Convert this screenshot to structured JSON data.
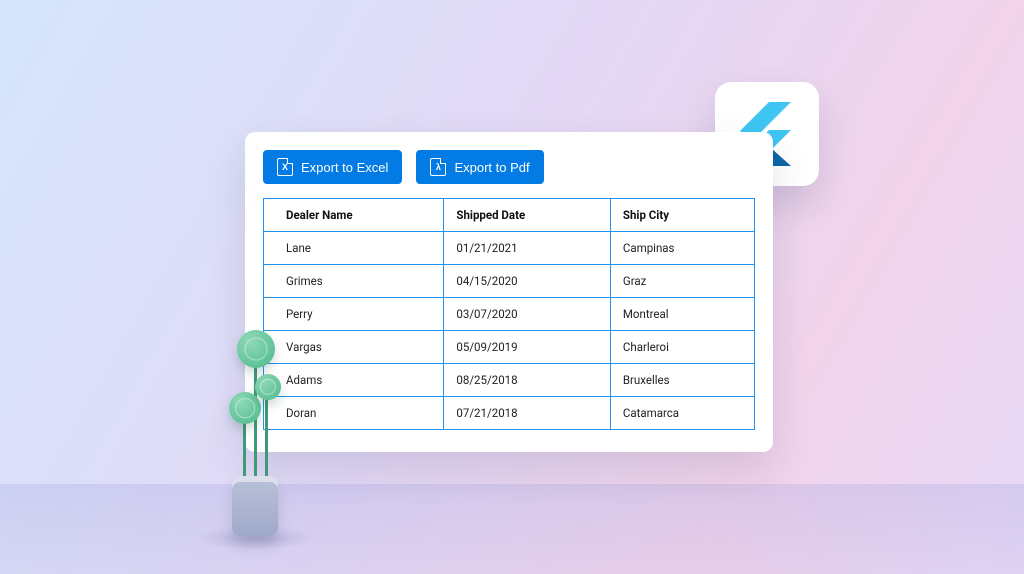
{
  "toolbar": {
    "excel_label": "Export to Excel",
    "excel_glyph": "X",
    "pdf_label": "Export to Pdf",
    "pdf_glyph": "λ"
  },
  "table": {
    "headers": [
      "Dealer Name",
      "Shipped Date",
      "Ship City"
    ],
    "rows": [
      {
        "dealer": "Lane",
        "date": "01/21/2021",
        "city": "Campinas"
      },
      {
        "dealer": "Grimes",
        "date": "04/15/2020",
        "city": "Graz"
      },
      {
        "dealer": "Perry",
        "date": "03/07/2020",
        "city": "Montreal"
      },
      {
        "dealer": "Vargas",
        "date": "05/09/2019",
        "city": "Charleroi"
      },
      {
        "dealer": "Adams",
        "date": "08/25/2018",
        "city": "Bruxelles"
      },
      {
        "dealer": "Doran",
        "date": "07/21/2018",
        "city": "Catamarca"
      }
    ]
  },
  "colors": {
    "accent": "#037be5",
    "border": "#2293ef"
  }
}
